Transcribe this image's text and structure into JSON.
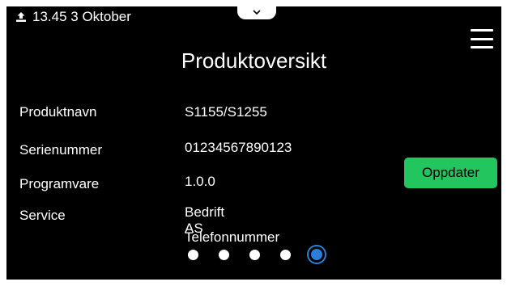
{
  "status_bar": {
    "icon": "upload-icon",
    "datetime": "13.45 3 Oktober"
  },
  "header": {
    "pull_tab_icon": "chevron-down-icon",
    "menu_icon": "hamburger-menu-icon",
    "title": "Produktoversikt"
  },
  "product_info": [
    {
      "label": "Produktnavn",
      "value": "S1155/S1255"
    },
    {
      "label": "Serienummer",
      "value": "01234567890123"
    },
    {
      "label": "Programvare",
      "value": "1.0.0"
    },
    {
      "label": "Service",
      "value": "Bedrift AS"
    },
    {
      "label": "",
      "value": "Telefonnummer"
    }
  ],
  "actions": {
    "update_label": "Oppdater",
    "update_color": "#22c55e"
  },
  "pager": {
    "page_count": 5,
    "active_page": 5,
    "active_color": "#2b7fd6"
  }
}
